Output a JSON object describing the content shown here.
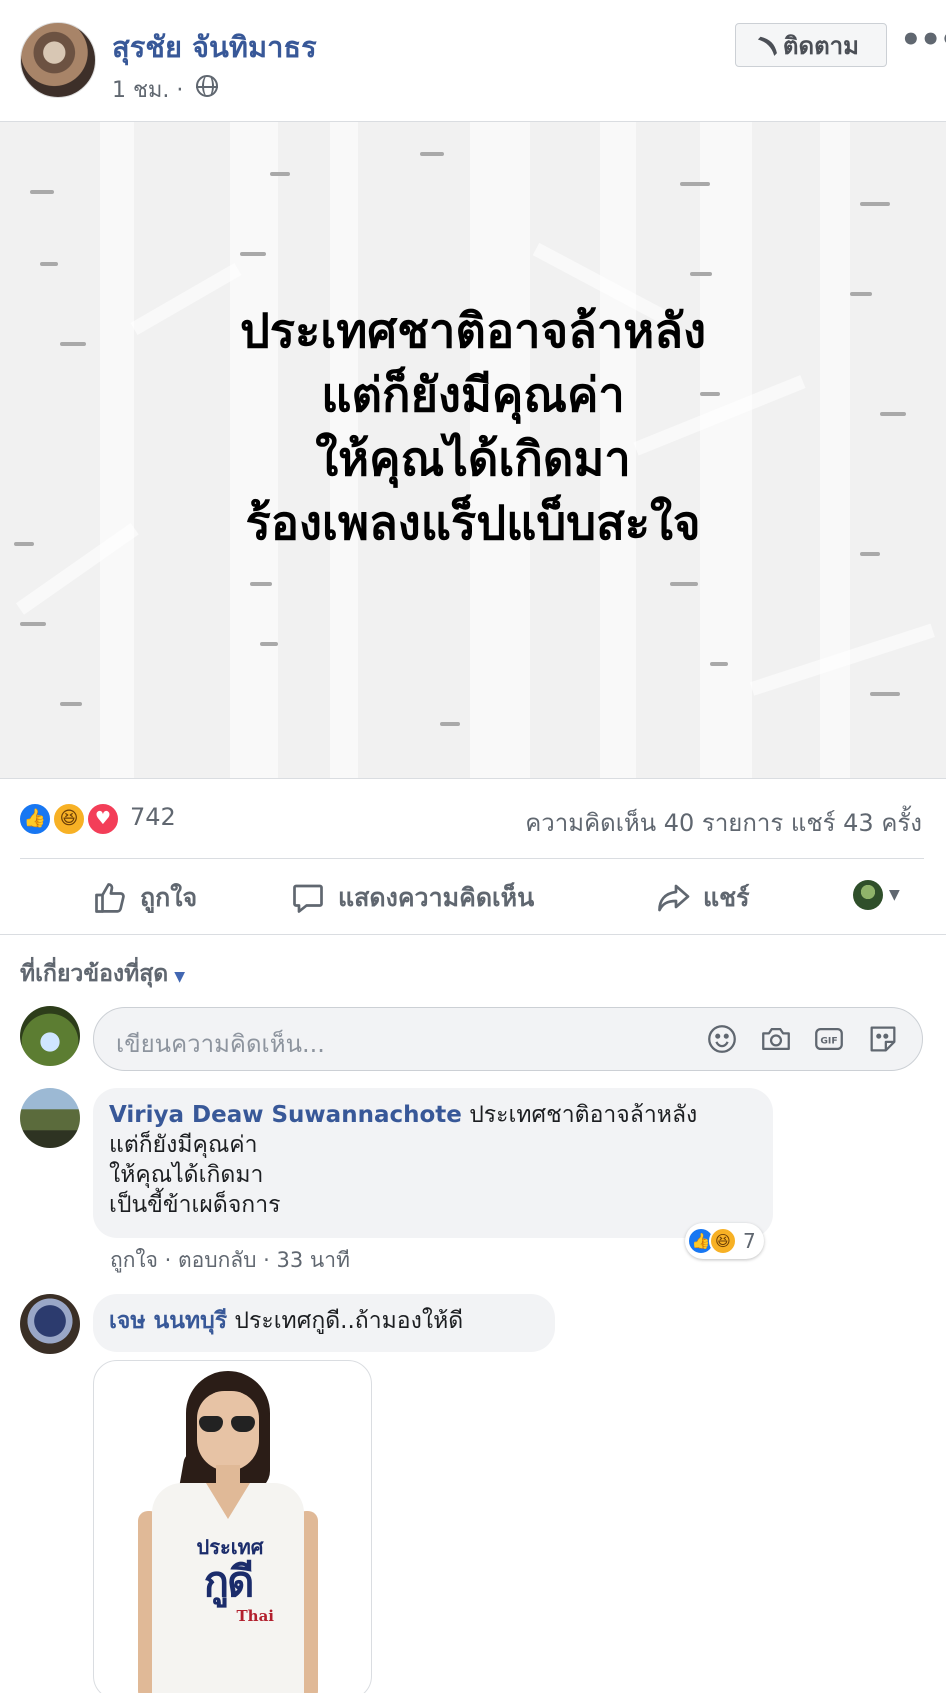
{
  "post": {
    "author": "สุรชัย จันทิมาธร",
    "time": "1 ชม. ·",
    "follow_label": "ติดตาม",
    "quote_lines": [
      "ประเทศชาติอาจล้าหลัง",
      "แต่ก็ยังมีคุณค่า",
      "ให้คุณได้เกิดมา",
      "ร้องเพลงแร็ปแบ็บสะใจ"
    ]
  },
  "stats": {
    "reaction_count": "742",
    "comments_shares": "ความคิดเห็น 40 รายการ แชร์ 43 ครั้ง"
  },
  "actions": {
    "like": "ถูกใจ",
    "comment": "แสดงความคิดเห็น",
    "share": "แชร์"
  },
  "comments_filter": "ที่เกี่ยวข้องที่สุด",
  "composer": {
    "placeholder": "เขียนความคิดเห็น..."
  },
  "comments": [
    {
      "author": "Viriya Deaw Suwannachote",
      "text_first": "ประเทศชาติอาจล้าหลัง",
      "text_rest": "แต่ก็ยังมีคุณค่า\nให้คุณได้เกิดมา\nเป็นขี้ข้าเผด็จการ",
      "meta": "ถูกใจ · ตอบกลับ · 33 นาที",
      "reaction_count": "7"
    },
    {
      "author": "เจษ นนทบุรี",
      "text": "ประเทศกูดี..ถ้ามองให้ดี",
      "attachment": {
        "line1": "ประเทศ",
        "line2": "กูดี",
        "line3": "Thai"
      }
    }
  ],
  "colors": {
    "link_blue": "#385898",
    "like_blue": "#1877f2",
    "love_red": "#f33e58",
    "haha_yellow": "#f7b125"
  },
  "icons": [
    "rss-icon",
    "more-icon",
    "globe-icon",
    "thumbs-up-icon",
    "comment-icon",
    "share-icon",
    "emoji-icon",
    "camera-icon",
    "gif-icon",
    "sticker-icon",
    "caret-down-icon"
  ]
}
